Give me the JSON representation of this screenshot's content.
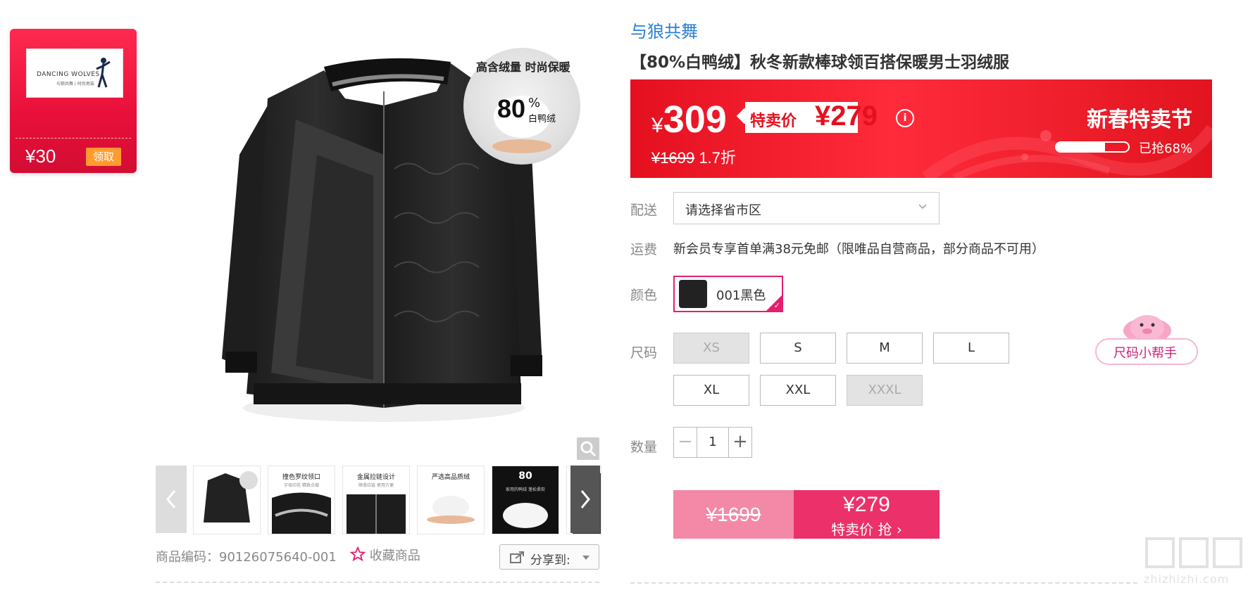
{
  "brand_coupon": {
    "logo_text": "DANCING WOLVES",
    "logo_sub": "与狼共舞 | 时尚男装",
    "amount": "¥30",
    "claim_label": "领取"
  },
  "gallery": {
    "badge_top": "高含绒量 时尚保暖",
    "badge_percent": "80",
    "badge_percent_sign": "%",
    "badge_sub": "白鸭绒",
    "thumbnails": [
      {
        "caption": "",
        "sub": ""
      },
      {
        "caption": "撞色罗纹领口",
        "sub": "字母印花 精致点缀"
      },
      {
        "caption": "金属拉链设计",
        "sub": "顺滑拉链 使用方便"
      },
      {
        "caption": "严选高品质绒",
        "sub": ""
      },
      {
        "caption": "80",
        "sub": "家用的鸭绒 蓬松柔软"
      },
      {
        "caption": "",
        "sub": ""
      }
    ]
  },
  "meta": {
    "sku_code": "商品编码：90126075640-001",
    "favorite_label": "收藏商品",
    "share_label": "分享到:"
  },
  "product": {
    "brand": "与狼共舞",
    "title": "【80%白鸭绒】秋冬新款棒球领百搭保暖男士羽绒服"
  },
  "price": {
    "currency": "¥",
    "current": "309",
    "sale_label": "特卖价",
    "sale_price": "¥279",
    "original": "¥1699",
    "discount": "1.7折",
    "festival": "新春特卖节",
    "progress_text": "已抢68%",
    "progress_percent": 68,
    "banner_color": "#e4101f"
  },
  "shipping": {
    "delivery_label": "配送",
    "region_placeholder": "请选择省市区",
    "fee_label": "运费",
    "fee_text": "新会员专享首单满38元免邮（限唯品自营商品，部分商品不可用）"
  },
  "color": {
    "label": "颜色",
    "options": [
      {
        "name": "001黑色",
        "selected": true
      }
    ]
  },
  "size": {
    "label": "尺码",
    "options": [
      {
        "name": "XS",
        "disabled": true
      },
      {
        "name": "S",
        "disabled": false
      },
      {
        "name": "M",
        "disabled": false
      },
      {
        "name": "L",
        "disabled": false
      },
      {
        "name": "XL",
        "disabled": false
      },
      {
        "name": "XXL",
        "disabled": false
      },
      {
        "name": "XXXL",
        "disabled": true
      }
    ],
    "helper_label": "尺码小帮手"
  },
  "quantity": {
    "label": "数量",
    "minus": "−",
    "value": "1",
    "plus": "+"
  },
  "buy": {
    "original_price": "¥1699",
    "sale_price": "¥279",
    "action_label": "特卖价 抢 ›",
    "accent_color": "#ec3069"
  },
  "watermark": {
    "text": "zhizhizhi.com"
  }
}
